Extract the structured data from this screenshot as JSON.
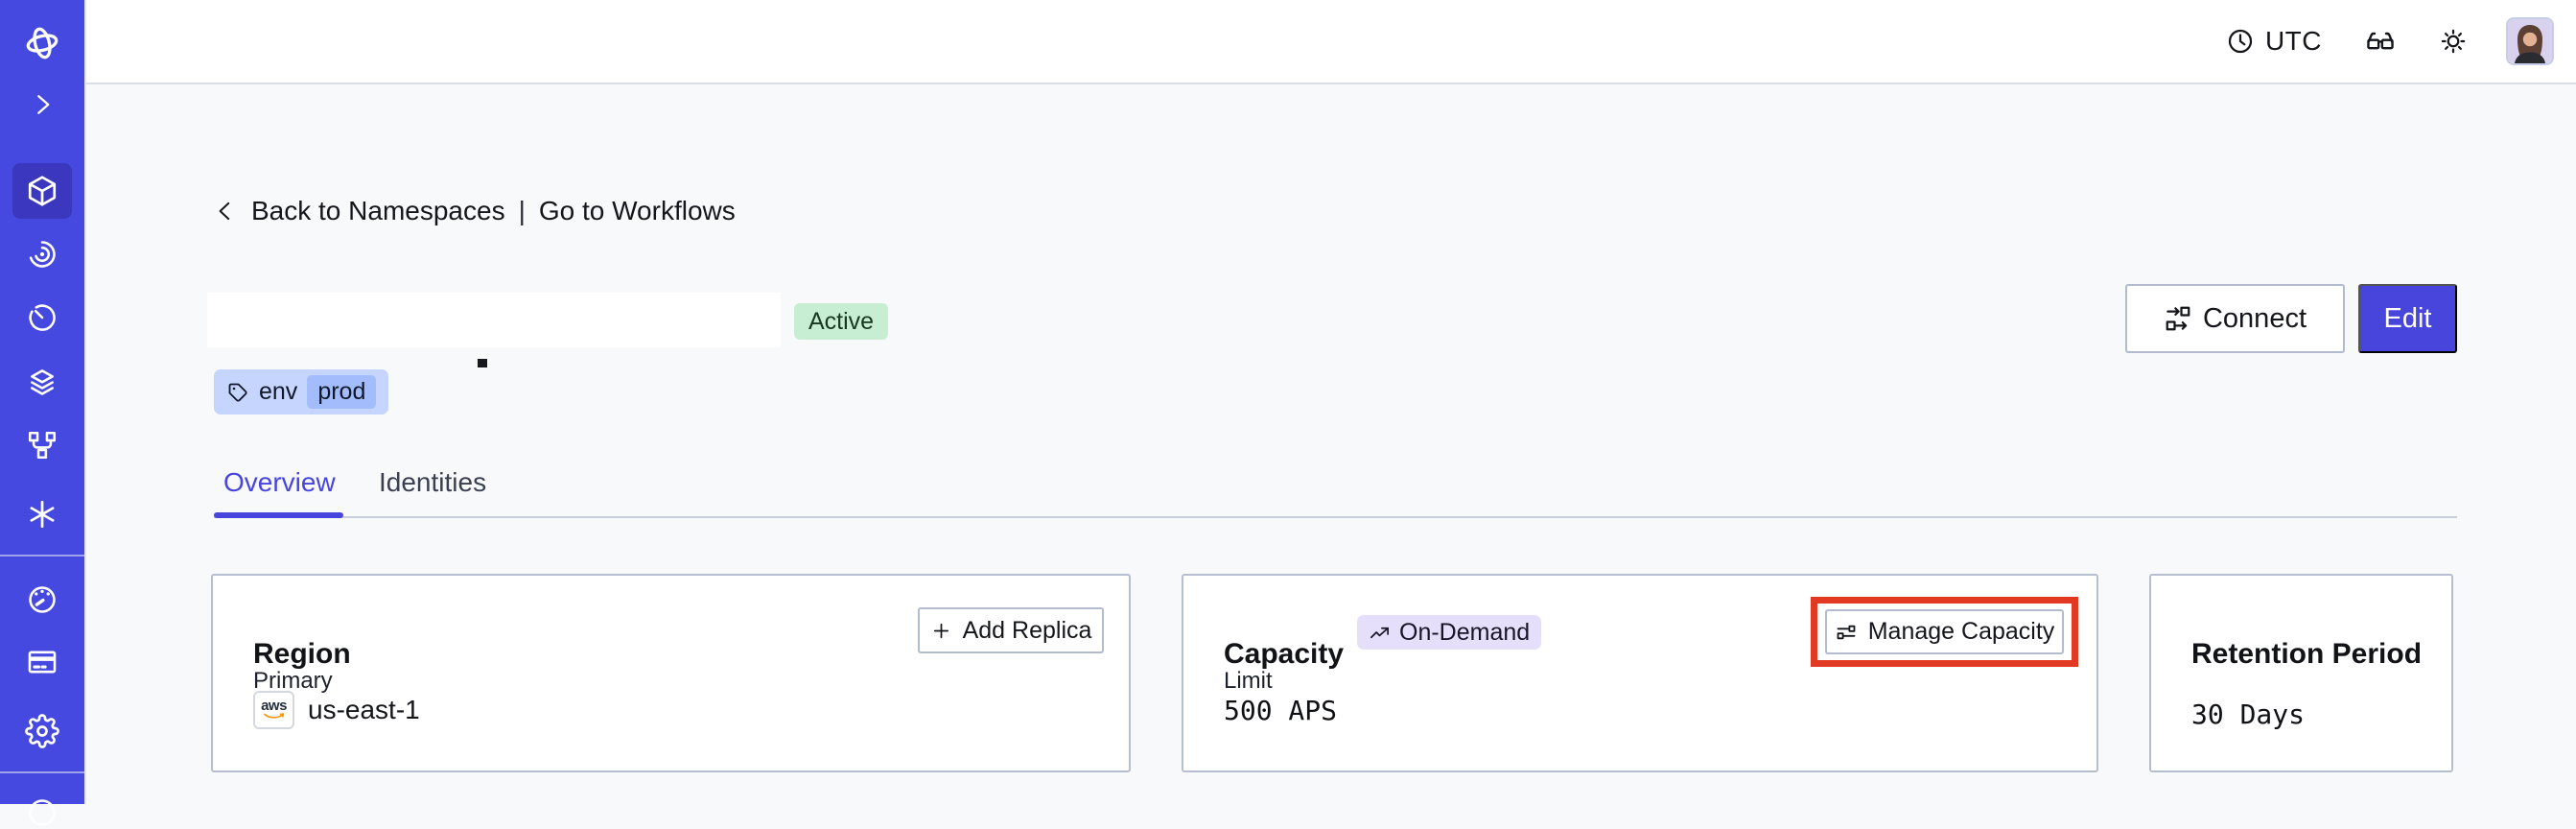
{
  "topbar": {
    "timezone": "UTC",
    "icons": [
      "clock",
      "glasses",
      "sun-theme",
      "user-avatar"
    ]
  },
  "sidebar": {
    "icons": [
      "temporal-logo",
      "expand-chevron",
      "namespaces-cube",
      "workflows-spiral",
      "schedules-timer",
      "batch-layers",
      "deployments-branch",
      "nexus-asterisk",
      "usage-gauge",
      "billing-card",
      "settings-gear",
      "help-partial"
    ],
    "active_item": "namespaces"
  },
  "breadcrumb": {
    "back": "Back to Namespaces",
    "divider": "|",
    "forward": "Go to Workflows"
  },
  "namespace": {
    "title_redacted": true,
    "status": "Active",
    "tag": {
      "key": "env",
      "value": "prod"
    }
  },
  "actions": {
    "connect": "Connect",
    "edit": "Edit"
  },
  "tabs": [
    {
      "label": "Overview",
      "active": true
    },
    {
      "label": "Identities",
      "active": false
    }
  ],
  "cards": {
    "region": {
      "title": "Region",
      "action": "Add Replica",
      "label": "Primary",
      "provider": "aws",
      "value": "us-east-1"
    },
    "capacity": {
      "title": "Capacity",
      "badge": "On-Demand",
      "action": "Manage Capacity",
      "label": "Limit",
      "value": "500 APS",
      "action_highlighted": true
    },
    "retention": {
      "title": "Retention Period",
      "value": "30 Days"
    }
  },
  "colors": {
    "accent_indigo": "#4745DC",
    "sidebar_bg": "#4649E0",
    "sidebar_active_tile": "#3B38BF",
    "highlight_red": "#E23A22",
    "status_green_bg": "#C7EDD3",
    "tag_blue_bg": "#C5D5FD",
    "tag_chip_bg": "#A3BCFC",
    "ondemand_purple_bg": "#E6DFFB",
    "page_bg": "#F8F9FB",
    "card_border": "#B6BFD0",
    "aws_orange": "#F89500"
  }
}
